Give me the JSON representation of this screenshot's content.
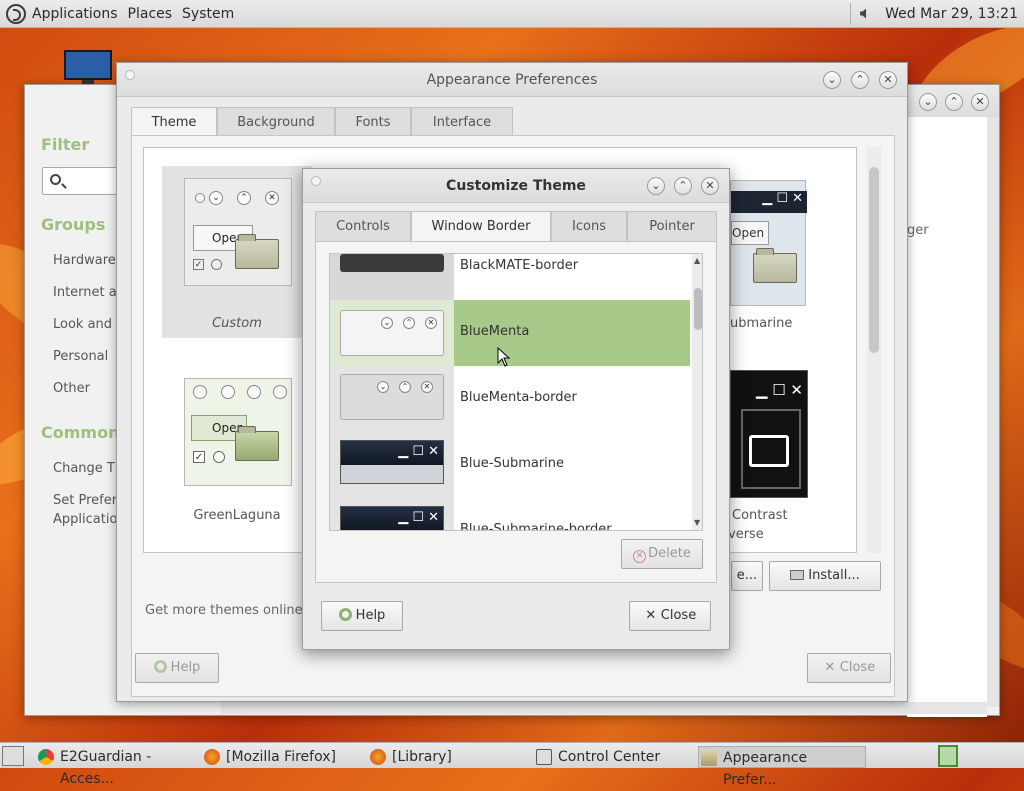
{
  "top_panel": {
    "menus": [
      "Applications",
      "Places",
      "System"
    ],
    "clock": "Wed Mar 29, 13:21"
  },
  "control_center": {
    "filter_heading": "Filter",
    "groups_heading": "Groups",
    "group_items": [
      "Hardware",
      "Internet a",
      "Look and F",
      "Personal",
      "Other"
    ],
    "common_heading": "Common",
    "common_items": [
      "Change Th",
      "Set Prefer",
      "Application"
    ],
    "right_fragment": "ger"
  },
  "appearance": {
    "title": "Appearance Preferences",
    "tabs": [
      "Theme",
      "Background",
      "Fonts",
      "Interface"
    ],
    "themes": [
      {
        "name": "Custom"
      },
      {
        "name": "ubmarine"
      },
      {
        "name": "GreenLaguna"
      },
      {
        "name": "Contrast"
      },
      {
        "name": "verse"
      }
    ],
    "thumb_open_label": "Open",
    "get_more_label": "Get more themes online",
    "customize_button_fragment": "e...",
    "install_button": "Install...",
    "help_button": "Help",
    "close_button": "Close"
  },
  "customize": {
    "title": "Customize Theme",
    "tabs": [
      "Controls",
      "Window Border",
      "Icons",
      "Pointer"
    ],
    "rows": [
      {
        "label": "BlackMATE-border"
      },
      {
        "label": "BlueMenta"
      },
      {
        "label": "BlueMenta-border"
      },
      {
        "label": "Blue-Submarine"
      },
      {
        "label": "Blue-Submarine-border"
      }
    ],
    "delete_button": "Delete",
    "help_button": "Help",
    "close_button": "Close",
    "selected_color": "#a7c98a"
  },
  "taskbar": {
    "items": [
      {
        "label": "E2Guardian - Acces...",
        "icon": "chrome-icon"
      },
      {
        "label": "[Mozilla Firefox]",
        "icon": "firefox-icon"
      },
      {
        "label": "[Library]",
        "icon": "firefox-icon"
      },
      {
        "label": "Control Center",
        "icon": "control-center-icon"
      },
      {
        "label": "Appearance Prefer...",
        "icon": "appearance-icon"
      }
    ]
  }
}
